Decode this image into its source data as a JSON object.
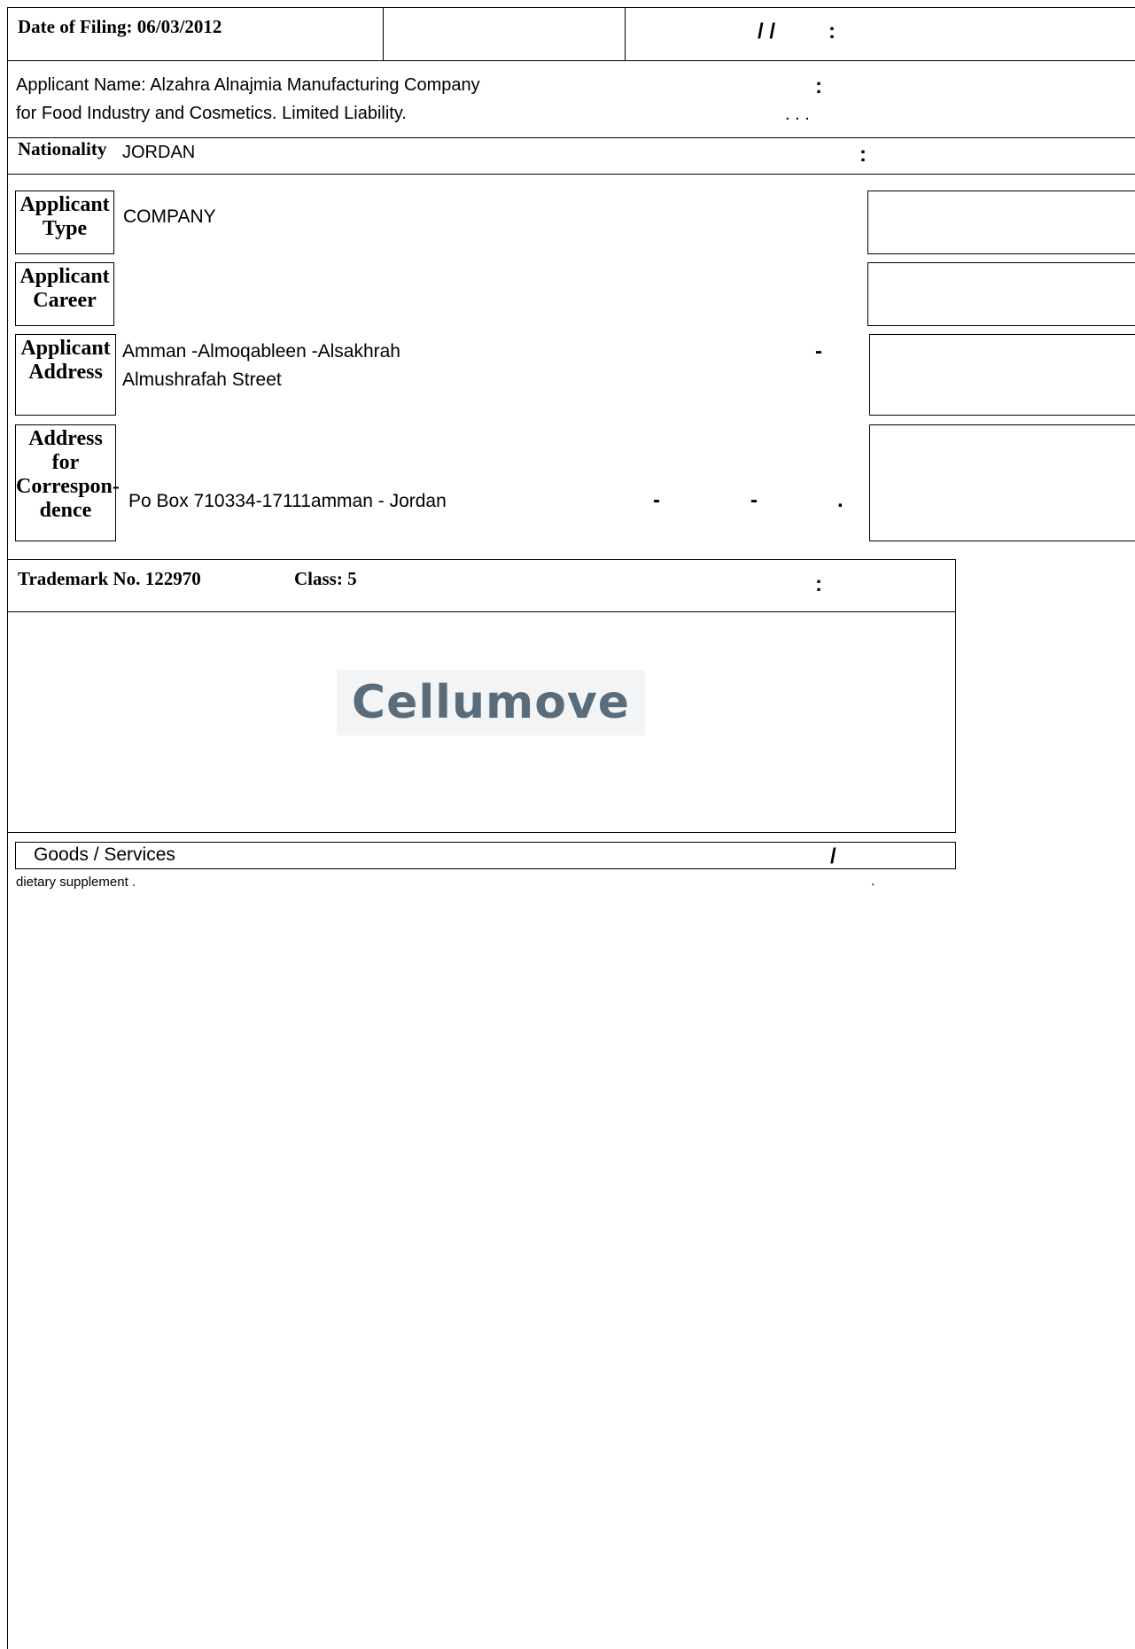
{
  "filing": {
    "label": "Date of Filing:",
    "date": "06/03/2012",
    "ar_date": "/   /",
    "ar_colon": ":"
  },
  "applicant": {
    "name_line1": "Applicant Name: Alzahra Alnajmia Manufacturing Company",
    "name_line2": "for Food Industry and Cosmetics. Limited Liability.",
    "ar_colon": ":",
    "ar_dots": ". . ."
  },
  "nationality": {
    "label": "Nationality",
    "value": "JORDAN",
    "ar_colon": ":"
  },
  "type": {
    "label_line1": "Applicant",
    "label_line2": "Type",
    "value": "COMPANY"
  },
  "career": {
    "label_line1": "Applicant",
    "label_line2": "Career",
    "value": ""
  },
  "address": {
    "label_line1": "Applicant",
    "label_line2": "Address",
    "line1": "Amman -Almoqableen -Alsakhrah",
    "line2": "Almushrafah Street",
    "ar_dash": "-"
  },
  "correspondence": {
    "label_line1": "Address for",
    "label_line2": "Correspon-",
    "label_line3": "dence",
    "value": "Po Box 710334-17111amman - Jordan",
    "ar_dash1": "-",
    "ar_dash2": "-",
    "ar_dot": "."
  },
  "trademark": {
    "label": "Trademark No.",
    "number": "122970",
    "class_label": "Class:",
    "class_value": "5",
    "ar_colon": ":"
  },
  "logo": {
    "text": "Cellumove",
    "color": "#5a6b7a"
  },
  "goods": {
    "header": "Goods / Services",
    "ar_slash": "/",
    "item": "dietary supplement .",
    "ar_dot": "."
  }
}
